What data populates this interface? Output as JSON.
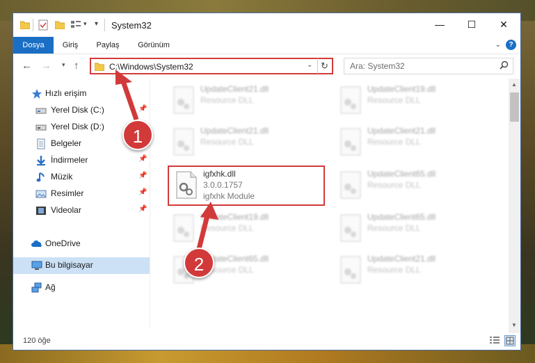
{
  "window": {
    "title": "System32",
    "controls": {
      "minimize": "—",
      "maximize": "☐",
      "close": "✕"
    }
  },
  "ribbon": {
    "tabs": [
      "Dosya",
      "Giriş",
      "Paylaş",
      "Görünüm"
    ],
    "active_tab": "Dosya",
    "help": "?"
  },
  "nav": {
    "address": "C:\\Windows\\System32",
    "search_placeholder": "Ara: System32"
  },
  "sidebar": {
    "items": [
      {
        "label": "Hızlı erişim",
        "icon": "star-icon",
        "pinned": false
      },
      {
        "label": "Yerel Disk (C:)",
        "icon": "drive-icon",
        "pinned": true
      },
      {
        "label": "Yerel Disk (D:)",
        "icon": "drive-icon",
        "pinned": true
      },
      {
        "label": "Belgeler",
        "icon": "documents-icon",
        "pinned": true
      },
      {
        "label": "İndirmeler",
        "icon": "download-icon",
        "pinned": true
      },
      {
        "label": "Müzik",
        "icon": "music-icon",
        "pinned": true
      },
      {
        "label": "Resimler",
        "icon": "pictures-icon",
        "pinned": true
      },
      {
        "label": "Videolar",
        "icon": "videos-icon",
        "pinned": true
      },
      {
        "label": "OneDrive",
        "icon": "cloud-icon",
        "pinned": false
      },
      {
        "label": "Bu bilgisayar",
        "icon": "computer-icon",
        "pinned": false,
        "selected": true
      },
      {
        "label": "Ağ",
        "icon": "network-icon",
        "pinned": false
      }
    ]
  },
  "files": [
    {
      "name": "UpdateClient21.dll",
      "line2": "Resource DLL",
      "line3": "",
      "highlighted": false
    },
    {
      "name": "UpdateClient19.dll",
      "line2": "Resource DLL",
      "line3": "",
      "highlighted": false
    },
    {
      "name": "UpdateClient21.dll",
      "line2": "Resource DLL",
      "line3": "",
      "highlighted": false
    },
    {
      "name": "UpdateClient21.dll",
      "line2": "Resource DLL",
      "line3": "",
      "highlighted": false
    },
    {
      "name": "igfxhk.dll",
      "line2": "3.0.0.1757",
      "line3": "igfxhk Module",
      "highlighted": true
    },
    {
      "name": "UpdateClient65.dll",
      "line2": "Resource DLL",
      "line3": "",
      "highlighted": false
    },
    {
      "name": "UpdateClient19.dll",
      "line2": "Resource DLL",
      "line3": "",
      "highlighted": false
    },
    {
      "name": "UpdateClient65.dll",
      "line2": "Resource DLL",
      "line3": "",
      "highlighted": false
    },
    {
      "name": "UpdateClient65.dll",
      "line2": "Resource DLL",
      "line3": "",
      "highlighted": false
    },
    {
      "name": "UpdateClient21.dll",
      "line2": "Resource DLL",
      "line3": "",
      "highlighted": false
    }
  ],
  "status": {
    "count": "120 öğe"
  },
  "annotations": {
    "badge1": "1",
    "badge2": "2"
  },
  "colors": {
    "accent": "#1a6fc4",
    "highlight": "#d23a3a",
    "selected": "#cce1f5"
  }
}
